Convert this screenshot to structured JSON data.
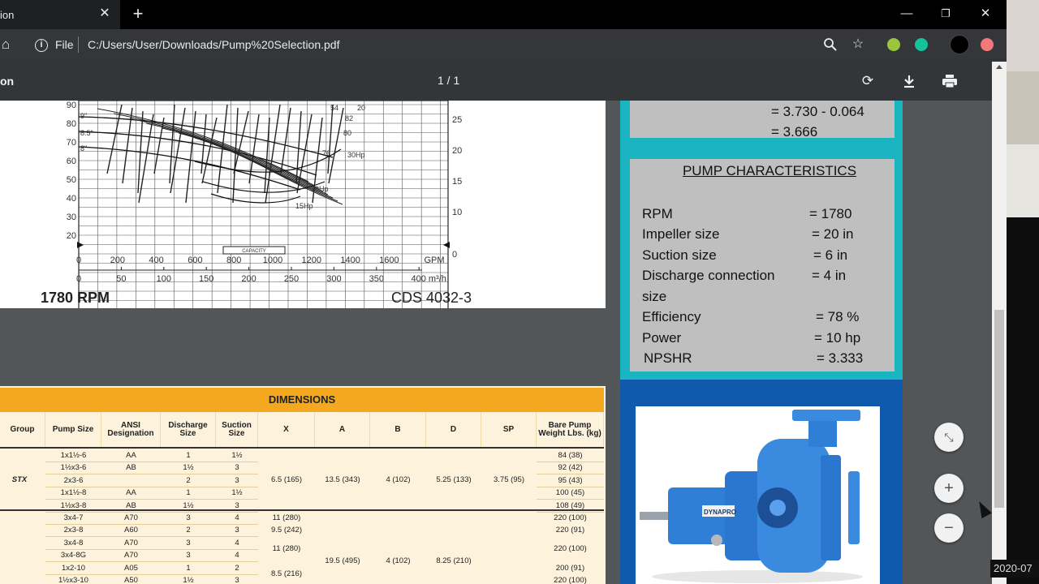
{
  "browser": {
    "tab_title": "ion",
    "url_scheme": "File",
    "url": "C:/Users/User/Downloads/Pump%20Selection.pdf"
  },
  "pdf_toolbar": {
    "title": "on",
    "page_indicator": "1 / 1"
  },
  "chart": {
    "rpm_label": "1780 RPM",
    "model_label": "CDS 4032-3",
    "y_ticks": [
      "90",
      "80",
      "70",
      "60",
      "50",
      "40",
      "30",
      "20"
    ],
    "gpm_ticks": [
      "0",
      "200",
      "400",
      "600",
      "800",
      "1000",
      "1200",
      "1400",
      "1600",
      "GPM"
    ],
    "m3h_ticks": [
      "0",
      "50",
      "100",
      "150",
      "200",
      "250",
      "300",
      "350",
      "400 m³/h"
    ],
    "right_ticks": [
      "25",
      "20",
      "15",
      "10",
      "0"
    ],
    "impeller_labels": [
      "9\"",
      "8.5\"",
      "8\""
    ],
    "hp_labels": [
      "30Hp",
      "20Hp",
      "15Hp"
    ],
    "efficiency_labels": [
      "82",
      "80",
      "76",
      "54",
      "20"
    ],
    "capacity_label": "CAPACITY"
  },
  "dimensions": {
    "title": "DIMENSIONS",
    "columns": [
      "Group",
      "Pump Size",
      "ANSI Designation",
      "Discharge Size",
      "Suction Size",
      "X",
      "A",
      "B",
      "D",
      "SP",
      "Bare Pump Weight Lbs. (kg)"
    ],
    "stx_group": "STX",
    "stx_rows": [
      {
        "size": "1x1½-6",
        "ansi": "AA",
        "discharge": "1",
        "suction": "1½",
        "weight": "84 (38)"
      },
      {
        "size": "1½x3-6",
        "ansi": "AB",
        "discharge": "1½",
        "suction": "3",
        "weight": "92 (42)"
      },
      {
        "size": "2x3-6",
        "ansi": "",
        "discharge": "2",
        "suction": "3",
        "weight": "95 (43)"
      },
      {
        "size": "1x1½-8",
        "ansi": "AA",
        "discharge": "1",
        "suction": "1½",
        "weight": "100 (45)"
      },
      {
        "size": "1½x3-8",
        "ansi": "AB",
        "discharge": "1½",
        "suction": "3",
        "weight": "108 (49)"
      }
    ],
    "stx_shared": {
      "x": "6.5 (165)",
      "a": "13.5 (343)",
      "b": "4 (102)",
      "d": "5.25 (133)",
      "sp": "3.75 (95)"
    },
    "mtx_rows": [
      {
        "size": "3x4-7",
        "ansi": "A70",
        "discharge": "3",
        "suction": "4",
        "weight": "220 (100)"
      },
      {
        "size": "2x3-8",
        "ansi": "A60",
        "discharge": "2",
        "suction": "3",
        "weight": "220 (91)"
      },
      {
        "size": "3x4-8",
        "ansi": "A70",
        "discharge": "3",
        "suction": "4",
        "weight": "220 (100)"
      },
      {
        "size": "3x4-8G",
        "ansi": "A70",
        "discharge": "3",
        "suction": "4",
        "weight": ""
      },
      {
        "size": "1x2-10",
        "ansi": "A05",
        "discharge": "1",
        "suction": "2",
        "weight": "200 (91)"
      },
      {
        "size": "1½x3-10",
        "ansi": "A50",
        "discharge": "1½",
        "suction": "3",
        "weight": "220 (100)"
      }
    ],
    "mtx_x": [
      "11 (280)",
      "9.5 (242)",
      "11 (280)",
      "8.5 (216)"
    ],
    "mtx_shared": {
      "a": "19.5 (495)",
      "b": "4 (102)",
      "d": "8.25 (210)"
    }
  },
  "slide": {
    "calc_line1": "= 3.730 - 0.064",
    "calc_line2": "= 3.666",
    "characteristics_title": "PUMP CHARACTERISTICS",
    "items": [
      {
        "label": "RPM",
        "value": "= 1780"
      },
      {
        "label": "Impeller size",
        "value": "= 20 in"
      },
      {
        "label": "Suction size",
        "value": "= 6 in"
      },
      {
        "label": "Discharge connection",
        "value": "= 4 in"
      },
      {
        "label": "size",
        "value": ""
      },
      {
        "label": "Efficiency",
        "value": "= 78 %"
      },
      {
        "label": "Power",
        "value": "= 10 hp"
      },
      {
        "label": "NPSHR",
        "value": "= 3.333"
      }
    ],
    "brand": "DYNAPRO"
  },
  "zoom": {
    "fit": "⤡",
    "in": "+",
    "out": "−"
  },
  "overlay": {
    "timestamp": "2020-07"
  }
}
